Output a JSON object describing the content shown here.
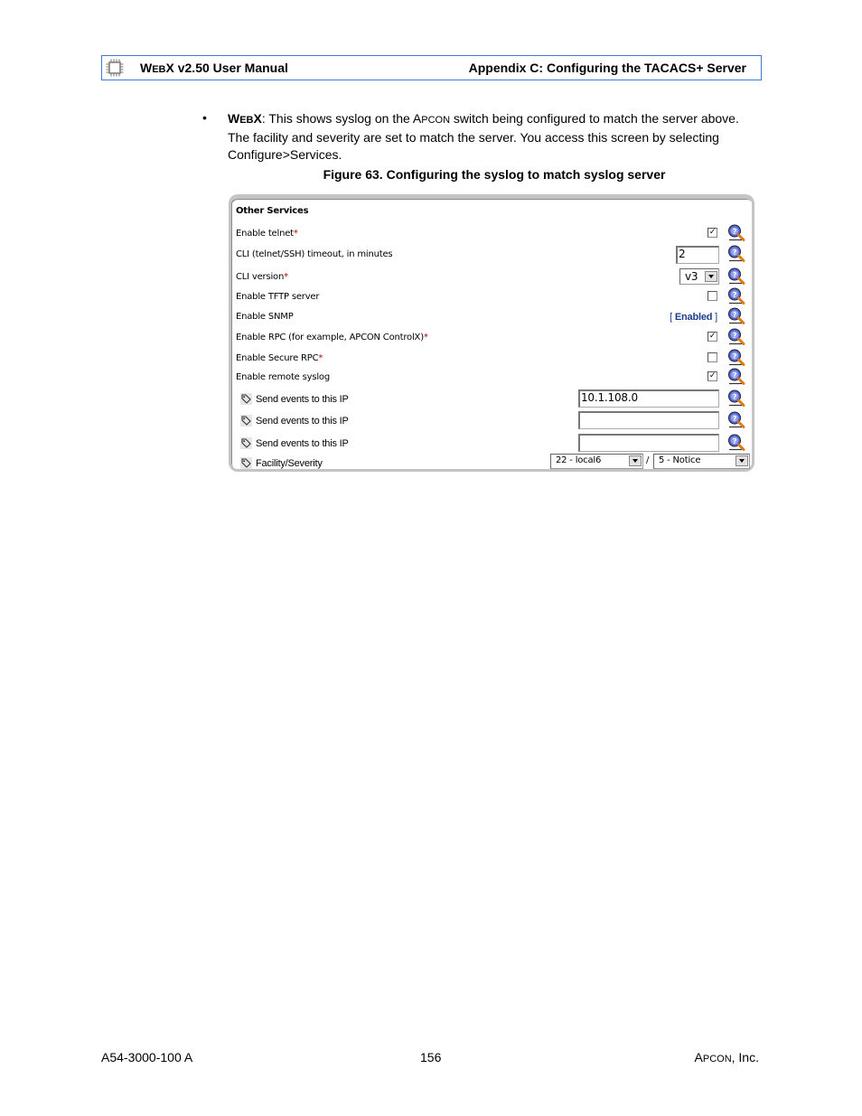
{
  "header": {
    "left_title_prefix": "W",
    "left_title_sc": "EB",
    "left_title_rest": "X v2.50 User Manual",
    "right_title": "Appendix C: Configuring the TACACS+ Server",
    "logo_icon": "chip-icon"
  },
  "body": {
    "bullet": "•",
    "lead_prefix": "W",
    "lead_sc": "EB",
    "lead_rest": "X",
    "text_1": ": This shows syslog on the A",
    "text_sc": "PCON",
    "text_2": " switch being configured to match the server above. The facility and severity are set to match the server. You access this screen by selecting Configure>Services.",
    "figure_caption": "Figure 63. Configuring the syslog to match syslog server"
  },
  "panel": {
    "title": "Other Services",
    "rows": [
      {
        "label": "Enable telnet",
        "required": "*",
        "control": "checkbox",
        "checked": true,
        "mark": "✓"
      },
      {
        "label": "CLI (telnet/SSH) timeout, in minutes",
        "control": "text",
        "value": "2"
      },
      {
        "label": "CLI version",
        "required": "*",
        "control": "select",
        "value": "v3"
      },
      {
        "label": "Enable TFTP server",
        "control": "checkbox",
        "checked": false
      },
      {
        "label": "Enable SNMP",
        "control": "status",
        "value_open": "[ ",
        "value": "Enabled",
        "value_close": " ]"
      },
      {
        "label": "Enable RPC (for example, APCON ControlX)",
        "required": "*",
        "control": "checkbox",
        "checked": true,
        "mark": "✓"
      },
      {
        "label": "Enable Secure RPC",
        "required": "*",
        "control": "checkbox",
        "checked": false
      },
      {
        "label": "Enable remote syslog",
        "control": "checkbox",
        "checked": true,
        "mark": "✓"
      },
      {
        "label": "Send events to this IP",
        "control": "text",
        "value": "10.1.108.0"
      },
      {
        "label": "Send events to this IP",
        "control": "text",
        "value": ""
      },
      {
        "label": "Send events to this IP",
        "control": "text",
        "value": ""
      },
      {
        "label": "Facility/Severity",
        "control": "select-pair",
        "facility": "22 - local6",
        "separator": "/",
        "severity": "5 - Notice"
      }
    ],
    "help_icon": "help-magnifier-icon"
  },
  "footer": {
    "doc_number": "A54-3000-100 A",
    "page_number": "156",
    "company_prefix": "A",
    "company_sc": "PCON",
    "company_rest": ", Inc."
  }
}
